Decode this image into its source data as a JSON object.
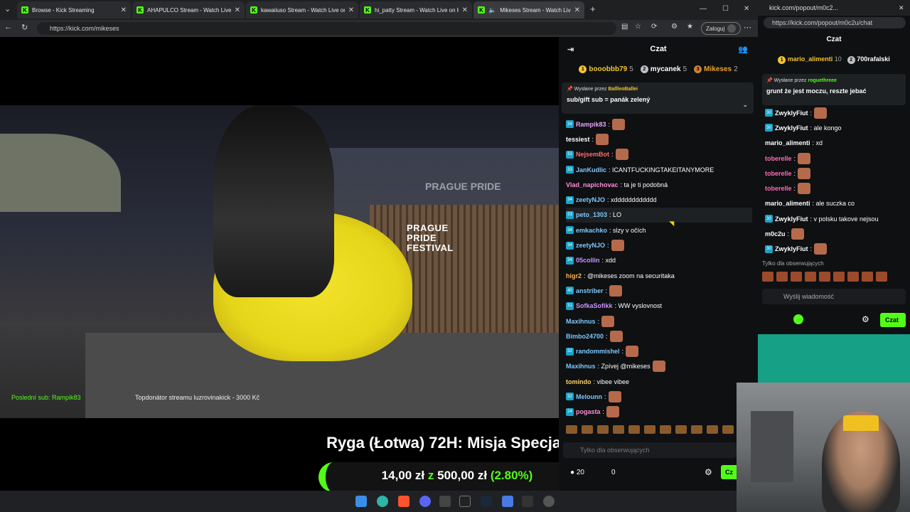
{
  "browser": {
    "tabs": [
      {
        "label": "Browse - Kick Streaming"
      },
      {
        "label": "AHAPULCO Stream - Watch Live o"
      },
      {
        "label": "kawaiiuso Stream - Watch Live on"
      },
      {
        "label": "hi_patty Stream - Watch Live on K"
      },
      {
        "label": "Mikeses Stream - Watch Live"
      }
    ],
    "new_tab": "+",
    "url": "https://kick.com/mikeses",
    "login_label": "Zaloguj",
    "win_min": "—",
    "win_max": "☐",
    "win_close": "✕"
  },
  "video": {
    "prague_text": "PRAGUE PRIDE",
    "festival_logo": "PRAGUE\nPRIDE\nFESTIVAL",
    "last_sub": "Poslední sub: Rampik83",
    "top_donator": "Topdonátor streamu luzrovinakick - 3000 Kč",
    "title_overlay": "Ryga (Łotwa) 72H: Misja Specjalna",
    "progress": {
      "current": "14,00 zł",
      "sep": "z",
      "goal": "500,00 zł",
      "percent": "(2.80%)",
      "fraction": 0.028
    }
  },
  "chat": {
    "title": "Czat",
    "leaderboard": [
      {
        "rank": "1",
        "name": "booobbb79",
        "count": "5",
        "color": "#f4c430"
      },
      {
        "rank": "2",
        "name": "mycanek",
        "count": "5",
        "color": "#c0c0c0"
      },
      {
        "rank": "3",
        "name": "Mikeses",
        "count": "2",
        "color": "#cd7f32"
      }
    ],
    "pinned": {
      "by_label": "Wysłane przez",
      "by_user": "BallleoBallei",
      "message": "sub/gift sub = panák zelený"
    },
    "messages": [
      {
        "badge": "34",
        "user": "Rampik83",
        "color": "#e8a0ff",
        "text": ":",
        "emote": true
      },
      {
        "badge": "",
        "user": "tessiest",
        "color": "#ffffff",
        "text": ":",
        "emote": true
      },
      {
        "badge": "31",
        "user": "NejsemBot",
        "color": "#ff6b6b",
        "text": ":",
        "emote": true
      },
      {
        "badge": "33",
        "user": "JanKudlic",
        "color": "#7ec8ff",
        "text": ": ICANTFUCKINGTAKEITANYMORE",
        "emote": false
      },
      {
        "badge": "",
        "user": "Vlad_napichovac",
        "color": "#ff8ad8",
        "text": ": ta je ti podobná",
        "emote": false
      },
      {
        "badge": "34",
        "user": "zeetyNJO",
        "color": "#7ec8ff",
        "text": ": xdddddddddddd",
        "emote": false
      },
      {
        "badge": "33",
        "user": "peto_1303",
        "color": "#7ec8ff",
        "text": ": LO",
        "emote": false
      },
      {
        "badge": "34",
        "user": "emkachko",
        "color": "#7ec8ff",
        "text": ": slzy v očích",
        "emote": false
      },
      {
        "badge": "34",
        "user": "zeetyNJO",
        "color": "#7ec8ff",
        "text": ":",
        "emote": true
      },
      {
        "badge": "34",
        "user": "05collin",
        "color": "#c792ff",
        "text": ": xdd",
        "emote": false
      },
      {
        "badge": "",
        "user": "higr2",
        "color": "#ffb347",
        "text": ": @mikeses zoom na securitaka",
        "emote": false
      },
      {
        "badge": "40",
        "user": "anstriber",
        "color": "#7ec8ff",
        "text": ":",
        "emote": true
      },
      {
        "badge": "31",
        "user": "SofkaSofikk",
        "color": "#c792ff",
        "text": ": WW vyslovnost",
        "emote": false
      },
      {
        "badge": "",
        "user": "Maxihnus",
        "color": "#7ec8ff",
        "text": ":",
        "emote": true
      },
      {
        "badge": "",
        "user": "Bimbo24700",
        "color": "#7ec8ff",
        "text": ":",
        "emote": true
      },
      {
        "badge": "32",
        "user": "randommishel",
        "color": "#7ec8ff",
        "text": ":",
        "emote": true
      },
      {
        "badge": "",
        "user": "Maxihnus",
        "color": "#7ec8ff",
        "text": ": Zpívej @mikeses",
        "emote": true
      },
      {
        "badge": "",
        "user": "tomindo",
        "color": "#ffd166",
        "text": ": vibee vibee",
        "emote": false
      },
      {
        "badge": "32",
        "user": "Melounn",
        "color": "#7ec8ff",
        "text": ":",
        "emote": true
      },
      {
        "badge": "24",
        "user": "pogasta",
        "color": "#ff8ad8",
        "text": ":",
        "emote": true
      }
    ],
    "input_placeholder": "Tylko dla obserwujących",
    "footer": {
      "points": "20",
      "second": "0",
      "send_label": "Cz"
    }
  },
  "popout": {
    "tab_url": "kick.com/popout/m0c2...",
    "url": "https://kick.com/popout/m0c2u/chat",
    "title": "Czat",
    "leaderboard": [
      {
        "rank": "1",
        "name": "mario_alimenti",
        "count": "10",
        "color": "#f4c430"
      },
      {
        "rank": "2",
        "name": "700rafalski",
        "count": "",
        "color": "#c0c0c0"
      }
    ],
    "pinned": {
      "by_label": "Wysłane przez",
      "by_user": "roguethreee",
      "message": "grunt że jest moczu, reszte jebać"
    },
    "messages": [
      {
        "badge": "30",
        "user": "ZwyklyFiut",
        "color": "#ffffff",
        "text": ":",
        "emote": true
      },
      {
        "badge": "30",
        "user": "ZwyklyFiut",
        "color": "#ffffff",
        "text": ": ale kongo",
        "emote": false
      },
      {
        "badge": "",
        "user": "mario_alimenti",
        "color": "#ffffff",
        "text": ": xd",
        "emote": false
      },
      {
        "badge": "",
        "user": "toberelle",
        "color": "#ff6bb5",
        "text": ":",
        "emote": true
      },
      {
        "badge": "",
        "user": "toberelle",
        "color": "#ff6bb5",
        "text": ":",
        "emote": true
      },
      {
        "badge": "",
        "user": "toberelle",
        "color": "#ff6bb5",
        "text": ":",
        "emote": true
      },
      {
        "badge": "",
        "user": "mario_alimenti",
        "color": "#ffffff",
        "text": ": ale suczka co",
        "emote": false
      },
      {
        "badge": "30",
        "user": "ZwyklyFiut",
        "color": "#ffffff",
        "text": ": v polsku takove nejsou",
        "emote": false
      },
      {
        "badge": "",
        "user": "m0c2u",
        "color": "#ffffff",
        "text": ":",
        "emote": true
      },
      {
        "badge": "30",
        "user": "ZwyklyFiut",
        "color": "#ffffff",
        "text": ":",
        "emote": true
      }
    ],
    "follow_only": "Tylko dla obserwujących",
    "input_placeholder": "Wyślij wiadomość",
    "send_label": "Czat"
  }
}
